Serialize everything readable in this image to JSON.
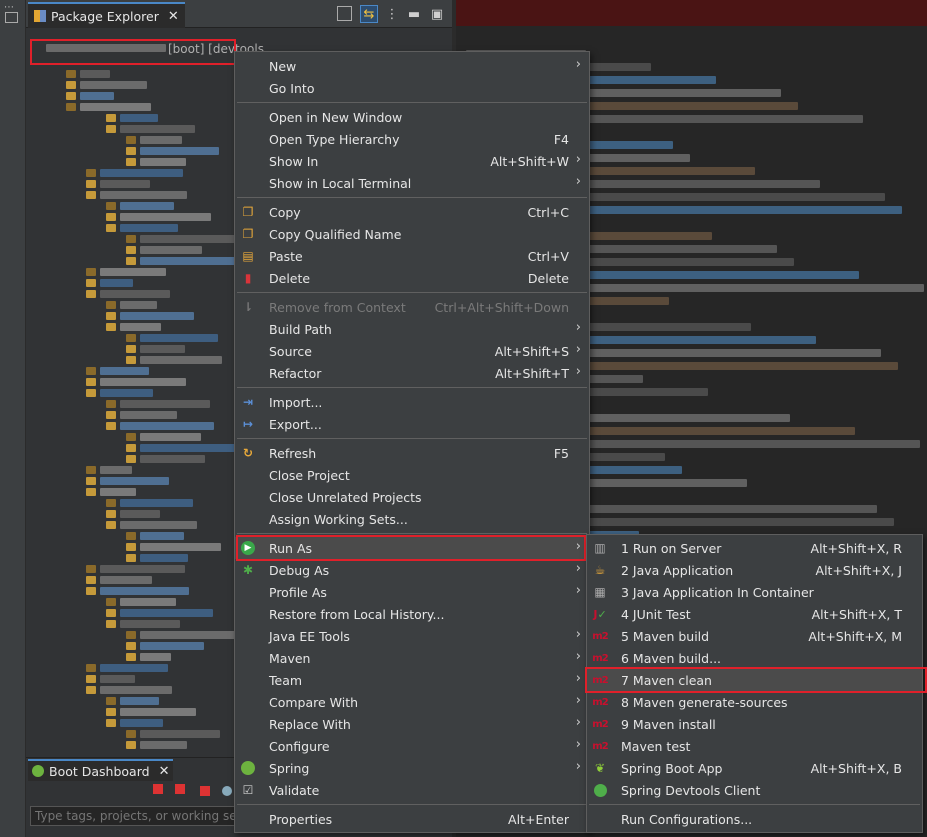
{
  "package_explorer": {
    "title": "Package Explorer",
    "project_suffix": "[boot] [devtools",
    "toolbar_icons": [
      "collapse-all-icon",
      "link-with-editor-icon",
      "view-menu-icon",
      "minimize-icon",
      "maximize-icon"
    ]
  },
  "boot_dashboard": {
    "title": "Boot Dashboard",
    "filter_placeholder": "Type tags, projects, or working set na"
  },
  "context_menu": {
    "items": [
      {
        "label": "New",
        "shortcut": "",
        "submenu": true
      },
      {
        "label": "Go Into",
        "shortcut": ""
      },
      {
        "label": "Open in New Window",
        "shortcut": ""
      },
      {
        "label": "Open Type Hierarchy",
        "shortcut": "F4"
      },
      {
        "label": "Show In",
        "shortcut": "Alt+Shift+W",
        "submenu": true
      },
      {
        "label": "Show in Local Terminal",
        "shortcut": "",
        "submenu": true
      },
      {
        "label": "Copy",
        "shortcut": "Ctrl+C",
        "icon": "copy-icon"
      },
      {
        "label": "Copy Qualified Name",
        "shortcut": "",
        "icon": "copy-qualified-icon"
      },
      {
        "label": "Paste",
        "shortcut": "Ctrl+V",
        "icon": "paste-icon"
      },
      {
        "label": "Delete",
        "shortcut": "Delete",
        "icon": "delete-icon"
      },
      {
        "label": "Remove from Context",
        "shortcut": "Ctrl+Alt+Shift+Down",
        "disabled": true,
        "icon": "remove-context-icon"
      },
      {
        "label": "Build Path",
        "shortcut": "",
        "submenu": true
      },
      {
        "label": "Source",
        "shortcut": "Alt+Shift+S",
        "submenu": true
      },
      {
        "label": "Refactor",
        "shortcut": "Alt+Shift+T",
        "submenu": true
      },
      {
        "label": "Import...",
        "shortcut": "",
        "icon": "import-icon"
      },
      {
        "label": "Export...",
        "shortcut": "",
        "icon": "export-icon"
      },
      {
        "label": "Refresh",
        "shortcut": "F5",
        "icon": "refresh-icon"
      },
      {
        "label": "Close Project",
        "shortcut": ""
      },
      {
        "label": "Close Unrelated Projects",
        "shortcut": ""
      },
      {
        "label": "Assign Working Sets...",
        "shortcut": ""
      },
      {
        "label": "Run As",
        "shortcut": "",
        "submenu": true,
        "icon": "run-icon"
      },
      {
        "label": "Debug As",
        "shortcut": "",
        "submenu": true,
        "icon": "debug-icon"
      },
      {
        "label": "Profile As",
        "shortcut": "",
        "submenu": true
      },
      {
        "label": "Restore from Local History...",
        "shortcut": ""
      },
      {
        "label": "Java EE Tools",
        "shortcut": "",
        "submenu": true
      },
      {
        "label": "Maven",
        "shortcut": "",
        "submenu": true
      },
      {
        "label": "Team",
        "shortcut": "",
        "submenu": true
      },
      {
        "label": "Compare With",
        "shortcut": "",
        "submenu": true
      },
      {
        "label": "Replace With",
        "shortcut": "",
        "submenu": true
      },
      {
        "label": "Configure",
        "shortcut": "",
        "submenu": true
      },
      {
        "label": "Spring",
        "shortcut": "",
        "submenu": true,
        "icon": "spring-icon"
      },
      {
        "label": "Validate",
        "shortcut": "",
        "icon": "validate-icon"
      },
      {
        "label": "Properties",
        "shortcut": "Alt+Enter"
      }
    ]
  },
  "run_as_menu": {
    "items": [
      {
        "label": "1 Run on Server",
        "shortcut": "Alt+Shift+X, R",
        "icon": "server-icon"
      },
      {
        "label": "2 Java Application",
        "shortcut": "Alt+Shift+X, J",
        "icon": "java-app-icon"
      },
      {
        "label": "3 Java Application In Container",
        "shortcut": "",
        "icon": "container-icon"
      },
      {
        "label": "4 JUnit Test",
        "shortcut": "Alt+Shift+X, T",
        "icon": "junit-icon"
      },
      {
        "label": "5 Maven build",
        "shortcut": "Alt+Shift+X, M",
        "icon": "maven-icon"
      },
      {
        "label": "6 Maven build...",
        "shortcut": "",
        "icon": "maven-icon"
      },
      {
        "label": "7 Maven clean",
        "shortcut": "",
        "icon": "maven-icon"
      },
      {
        "label": "8 Maven generate-sources",
        "shortcut": "",
        "icon": "maven-icon"
      },
      {
        "label": "9 Maven install",
        "shortcut": "",
        "icon": "maven-icon"
      },
      {
        "label": "Maven test",
        "shortcut": "",
        "icon": "maven-icon"
      },
      {
        "label": "Spring Boot App",
        "shortcut": "Alt+Shift+X, B",
        "icon": "spring-boot-icon"
      },
      {
        "label": "Spring Devtools Client",
        "shortcut": "",
        "icon": "devtools-icon"
      },
      {
        "label": "Run Configurations...",
        "shortcut": ""
      }
    ]
  },
  "colors": {
    "highlight_box": "#e0202a",
    "menu_bg": "#3c3f41",
    "hover_bg": "#4b4b4b"
  }
}
